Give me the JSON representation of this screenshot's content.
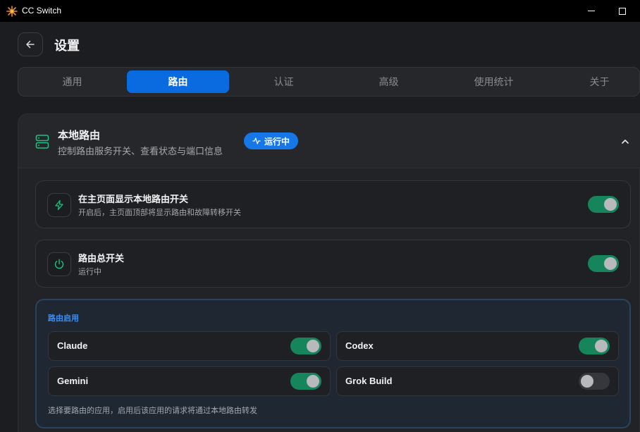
{
  "window": {
    "title": "CC Switch",
    "icon": "cc-switch-logo-icon"
  },
  "header": {
    "back_icon": "arrow-left-icon",
    "title": "设置"
  },
  "tabs": [
    {
      "label": "通用",
      "active": false
    },
    {
      "label": "路由",
      "active": true
    },
    {
      "label": "认证",
      "active": false
    },
    {
      "label": "高级",
      "active": false
    },
    {
      "label": "使用统计",
      "active": false
    },
    {
      "label": "关于",
      "active": false
    }
  ],
  "section": {
    "icon": "server-icon",
    "title": "本地路由",
    "subtitle": "控制路由服务开关、查看状态与端口信息",
    "status": {
      "label": "运行中",
      "icon": "activity-icon",
      "color": "#1677e8"
    },
    "collapse_icon": "chevron-up-icon"
  },
  "settings": [
    {
      "icon": "lightning-icon",
      "title": "在主页面显示本地路由开关",
      "description": "开启后，主页面顶部将显示路由和故障转移开关",
      "enabled": true
    },
    {
      "icon": "power-icon",
      "title": "路由总开关",
      "description": "运行中",
      "enabled": true
    }
  ],
  "routing": {
    "label": "路由启用",
    "apps": [
      {
        "name": "Claude",
        "enabled": true
      },
      {
        "name": "Codex",
        "enabled": true
      },
      {
        "name": "Gemini",
        "enabled": true
      },
      {
        "name": "Grok Build",
        "enabled": false
      }
    ],
    "hint": "选择要路由的应用，启用后该应用的请求将通过本地路由转发"
  },
  "colors": {
    "accent": "#0a6be0",
    "toggle_on": "#16855c",
    "toggle_off": "#35373c",
    "icon_green": "#19c37d"
  }
}
